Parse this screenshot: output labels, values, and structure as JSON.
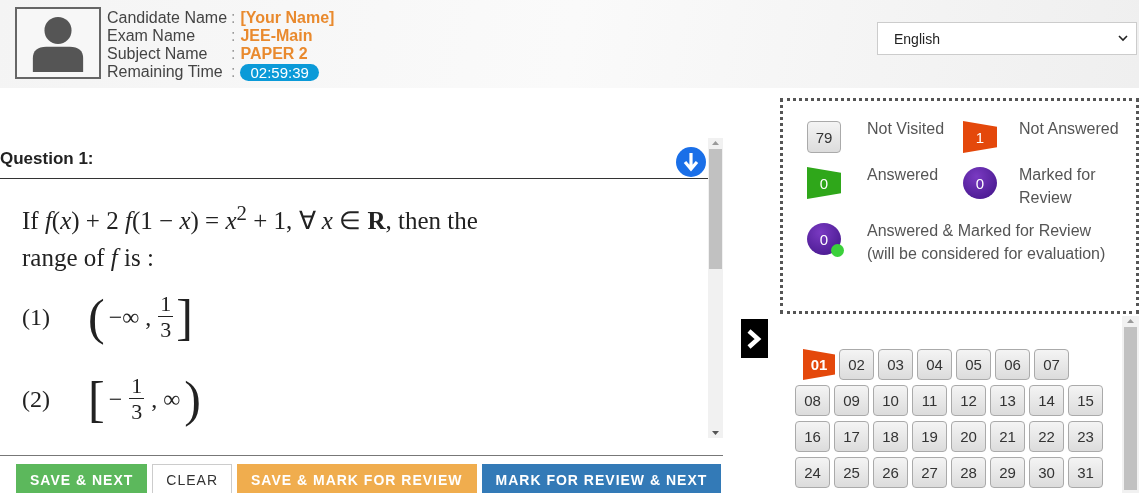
{
  "candidate": {
    "fields": [
      {
        "label": "Candidate Name",
        "separator": ":",
        "value": "[Your Name]",
        "kind": "text"
      },
      {
        "label": "Exam Name",
        "separator": ":",
        "value": "JEE-Main",
        "kind": "text"
      },
      {
        "label": "Subject Name",
        "separator": ":",
        "value": "PAPER 2",
        "kind": "text"
      },
      {
        "label": "Remaining Time",
        "separator": ":",
        "value": "02:59:39",
        "kind": "timer"
      }
    ]
  },
  "language": {
    "value": "English"
  },
  "question": {
    "title": "Question 1:",
    "text": "If *f*(*x*) + 2 *f*(1 − *x*) = *x*$^{2}$ + 1, ∀ *x* ∈ **R**, then the range of *f* is :",
    "options": [
      {
        "label": "(1)",
        "open": "(",
        "lead": "−∞ ,",
        "numerator": "1",
        "denominator": "3",
        "close": "]"
      },
      {
        "label": "(2)",
        "open": "[",
        "lead": "−",
        "numerator": "1",
        "denominator": "3",
        "trail": ", ∞",
        "close": ")"
      }
    ]
  },
  "actions": [
    {
      "label": "SAVE & NEXT",
      "kind": "green"
    },
    {
      "label": "CLEAR",
      "kind": "plain"
    },
    {
      "label": "SAVE & MARK FOR REVIEW",
      "kind": "orange"
    },
    {
      "label": "MARK FOR REVIEW & NEXT",
      "kind": "blue"
    }
  ],
  "legend": [
    {
      "count": "79",
      "label": "Not Visited",
      "kind": "not_visited"
    },
    {
      "count": "1",
      "label": "Not Answered",
      "kind": "not_answered"
    },
    {
      "count": "0",
      "label": "Answered",
      "kind": "answered"
    },
    {
      "count": "0",
      "label": "Marked for Review",
      "kind": "marked"
    },
    {
      "count": "0",
      "label": "Answered & Marked for Review",
      "note": "(will be considered for evaluation)",
      "kind": "answered_marked"
    }
  ],
  "palette": [
    {
      "number": "01",
      "kind": "not_answered",
      "selected": true
    },
    {
      "number": "02",
      "kind": "not_visited",
      "selected": false
    },
    {
      "number": "03",
      "kind": "not_visited",
      "selected": false
    },
    {
      "number": "04",
      "kind": "not_visited",
      "selected": false
    },
    {
      "number": "05",
      "kind": "not_visited",
      "selected": false
    },
    {
      "number": "06",
      "kind": "not_visited",
      "selected": false
    },
    {
      "number": "07",
      "kind": "not_visited",
      "selected": false
    },
    {
      "number": "08",
      "kind": "not_visited",
      "selected": false
    },
    {
      "number": "09",
      "kind": "not_visited",
      "selected": false
    },
    {
      "number": "10",
      "kind": "not_visited",
      "selected": false
    },
    {
      "number": "11",
      "kind": "not_visited",
      "selected": false
    },
    {
      "number": "12",
      "kind": "not_visited",
      "selected": false
    },
    {
      "number": "13",
      "kind": "not_visited",
      "selected": false
    },
    {
      "number": "14",
      "kind": "not_visited",
      "selected": false
    },
    {
      "number": "15",
      "kind": "not_visited",
      "selected": false
    },
    {
      "number": "16",
      "kind": "not_visited",
      "selected": false
    },
    {
      "number": "17",
      "kind": "not_visited",
      "selected": false
    },
    {
      "number": "18",
      "kind": "not_visited",
      "selected": false
    },
    {
      "number": "19",
      "kind": "not_visited",
      "selected": false
    },
    {
      "number": "20",
      "kind": "not_visited",
      "selected": false
    },
    {
      "number": "21",
      "kind": "not_visited",
      "selected": false
    },
    {
      "number": "22",
      "kind": "not_visited",
      "selected": false
    },
    {
      "number": "23",
      "kind": "not_visited",
      "selected": false
    },
    {
      "number": "24",
      "kind": "not_visited",
      "selected": false
    },
    {
      "number": "25",
      "kind": "not_visited",
      "selected": false
    },
    {
      "number": "26",
      "kind": "not_visited",
      "selected": false
    },
    {
      "number": "27",
      "kind": "not_visited",
      "selected": false
    },
    {
      "number": "28",
      "kind": "not_visited",
      "selected": false
    },
    {
      "number": "29",
      "kind": "not_visited",
      "selected": false
    },
    {
      "number": "30",
      "kind": "not_visited",
      "selected": false
    },
    {
      "number": "31",
      "kind": "not_visited",
      "selected": false
    }
  ]
}
